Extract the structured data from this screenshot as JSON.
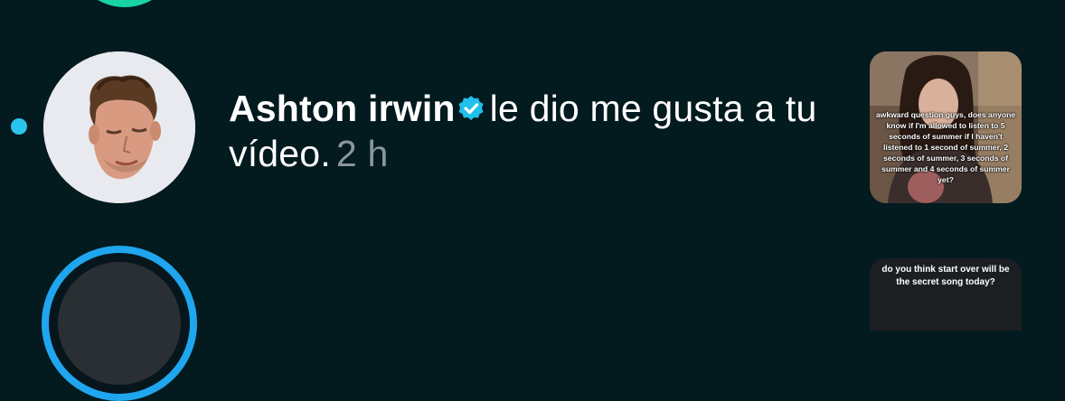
{
  "notification": {
    "user_name": "Ashton irwin",
    "verified_icon": "verified-badge-icon",
    "action_text": "le dio me gusta a tu vídeo.",
    "time": "2 h",
    "unread_color": "#2bc4ee",
    "video_caption": "awkward question guys, does anyone know if I'm allowed to listen to 5 seconds of summer if I haven't listened to 1 second of summer, 2 seconds of summer, 3 seconds of summer and 4 seconds of summer yet?"
  },
  "next_notification": {
    "video_caption": "do you think start over will be the secret song today?"
  },
  "colors": {
    "background": "#031a1f",
    "verified": "#20c0ea",
    "ring_top": "#18d3a6",
    "ring_bottom": "#1fa6ef"
  }
}
